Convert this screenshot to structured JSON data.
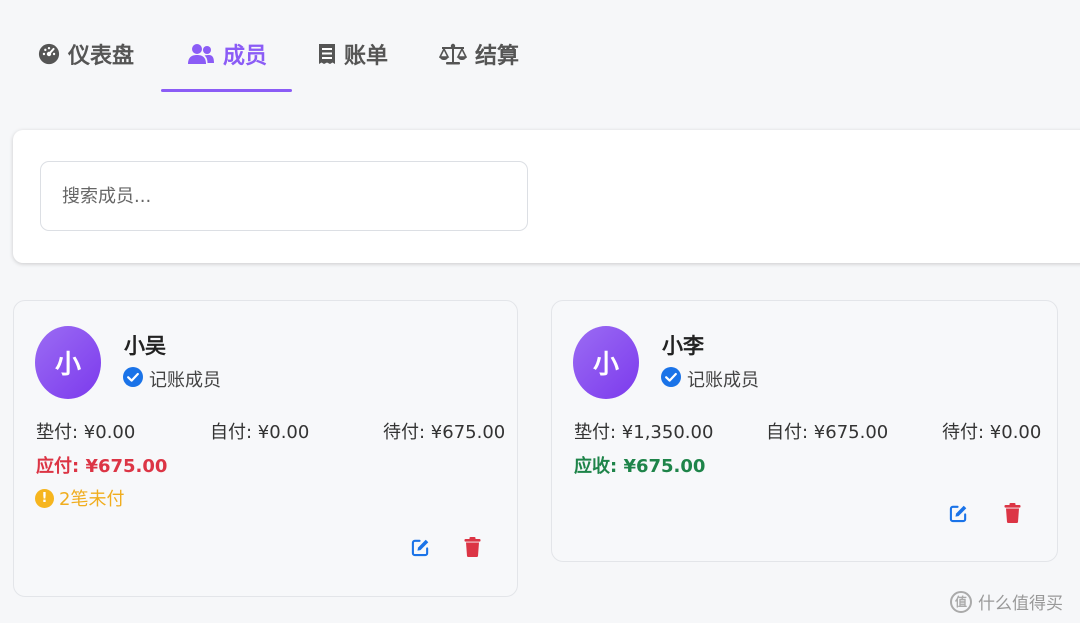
{
  "tabs": [
    {
      "label": "仪表盘",
      "icon": "dashboard-icon",
      "active": false
    },
    {
      "label": "成员",
      "icon": "users-icon",
      "active": true
    },
    {
      "label": "账单",
      "icon": "receipt-icon",
      "active": false
    },
    {
      "label": "结算",
      "icon": "scale-icon",
      "active": false
    }
  ],
  "search": {
    "placeholder": "搜索成员..."
  },
  "members": [
    {
      "avatar": "小",
      "name": "小吴",
      "role": "记账成员",
      "advanced": "垫付: ¥0.00",
      "self_paid": "自付: ¥0.00",
      "pending": "待付: ¥675.00",
      "balance": "应付: ¥675.00",
      "balance_type": "pay",
      "unpaid": "2笔未付"
    },
    {
      "avatar": "小",
      "name": "小李",
      "role": "记账成员",
      "advanced": "垫付: ¥1,350.00",
      "self_paid": "自付: ¥675.00",
      "pending": "待付: ¥0.00",
      "balance": "应收: ¥675.00",
      "balance_type": "receive"
    }
  ],
  "watermark": {
    "logo": "值",
    "text": "什么值得买"
  },
  "colors": {
    "accent": "#8b5cf6",
    "danger": "#dc3545",
    "success": "#1e8449",
    "warning": "#f0ad1e",
    "verified": "#1a73e8",
    "edit": "#1a73e8"
  }
}
